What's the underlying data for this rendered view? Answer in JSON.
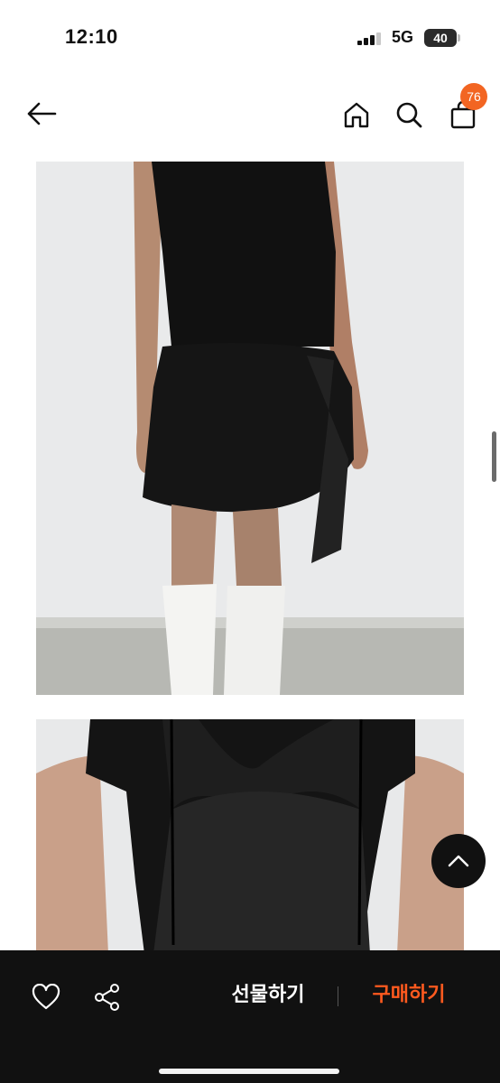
{
  "status_bar": {
    "time": "12:10",
    "network": "5G",
    "battery": "40"
  },
  "nav": {
    "back_icon": "arrow-left-icon",
    "home_icon": "home-icon",
    "search_icon": "search-icon",
    "cart_icon": "shopping-bag-icon",
    "cart_count": "76"
  },
  "product_images": [
    {
      "subject": "black skirt with tie sash, back view"
    },
    {
      "subject": "black slip top over t-shirt"
    }
  ],
  "actions": {
    "like_icon": "heart-icon",
    "share_icon": "share-icon",
    "gift_label": "선물하기",
    "buy_label": "구매하기",
    "scroll_top_icon": "chevron-up-icon"
  },
  "colors": {
    "accent": "#ff5a1f",
    "badge": "#f26522",
    "bottom_bar": "#111111"
  }
}
